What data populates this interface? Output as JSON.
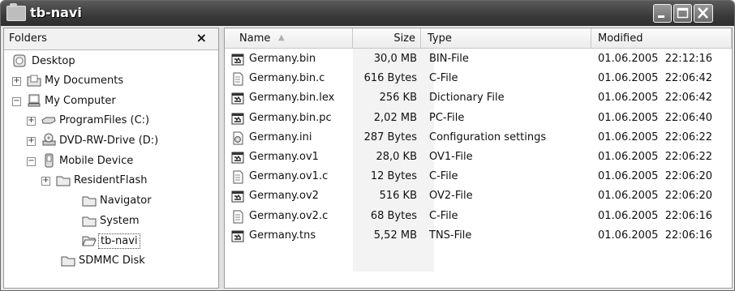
{
  "window": {
    "title": "tb-navi"
  },
  "folders_pane": {
    "header": "Folders",
    "close_label": "×",
    "items": [
      {
        "label": "Desktop",
        "expander": "",
        "icon": "desktop-icon"
      },
      {
        "label": "My Documents",
        "expander": "+",
        "icon": "documents-folder-icon"
      },
      {
        "label": "My Computer",
        "expander": "−",
        "icon": "computer-icon"
      },
      {
        "label": "ProgramFiles (C:)",
        "expander": "+",
        "icon": "drive-icon"
      },
      {
        "label": "DVD-RW-Drive (D:)",
        "expander": "+",
        "icon": "dvd-drive-icon"
      },
      {
        "label": "Mobile Device",
        "expander": "−",
        "icon": "mobile-device-icon"
      },
      {
        "label": "ResidentFlash",
        "expander": "+",
        "icon": "folder-icon"
      },
      {
        "label": "Navigator",
        "expander": "",
        "icon": "folder-icon"
      },
      {
        "label": "System",
        "expander": "",
        "icon": "folder-icon"
      },
      {
        "label": "tb-navi",
        "expander": "",
        "icon": "open-folder-icon"
      },
      {
        "label": "SDMMC Disk",
        "expander": "",
        "icon": "folder-icon"
      }
    ]
  },
  "file_list": {
    "columns": {
      "name": "Name",
      "size": "Size",
      "type": "Type",
      "modified": "Modified"
    },
    "sort_indicator": "▲",
    "rows": [
      {
        "name": "Germany.bin",
        "size": "30,0 MB",
        "type": "BIN-File",
        "modified": "01.06.2005  22:12:16",
        "icon": "app-file-icon"
      },
      {
        "name": "Germany.bin.c",
        "size": "616 Bytes",
        "type": "C-File",
        "modified": "01.06.2005  22:06:42",
        "icon": "text-file-icon"
      },
      {
        "name": "Germany.bin.lex",
        "size": "256 KB",
        "type": "Dictionary File",
        "modified": "01.06.2005  22:06:42",
        "icon": "app-file-icon"
      },
      {
        "name": "Germany.bin.pc",
        "size": "2,02 MB",
        "type": "PC-File",
        "modified": "01.06.2005  22:06:40",
        "icon": "app-file-icon"
      },
      {
        "name": "Germany.ini",
        "size": "287 Bytes",
        "type": "Configuration settings",
        "modified": "01.06.2005  22:06:22",
        "icon": "settings-file-icon"
      },
      {
        "name": "Germany.ov1",
        "size": "28,0 KB",
        "type": "OV1-File",
        "modified": "01.06.2005  22:06:22",
        "icon": "app-file-icon"
      },
      {
        "name": "Germany.ov1.c",
        "size": "12 Bytes",
        "type": "C-File",
        "modified": "01.06.2005  22:06:20",
        "icon": "text-file-icon"
      },
      {
        "name": "Germany.ov2",
        "size": "516 KB",
        "type": "OV2-File",
        "modified": "01.06.2005  22:06:20",
        "icon": "app-file-icon"
      },
      {
        "name": "Germany.ov2.c",
        "size": "68 Bytes",
        "type": "C-File",
        "modified": "01.06.2005  22:06:16",
        "icon": "text-file-icon"
      },
      {
        "name": "Germany.tns",
        "size": "5,52 MB",
        "type": "TNS-File",
        "modified": "01.06.2005  22:06:16",
        "icon": "app-file-icon"
      }
    ]
  }
}
